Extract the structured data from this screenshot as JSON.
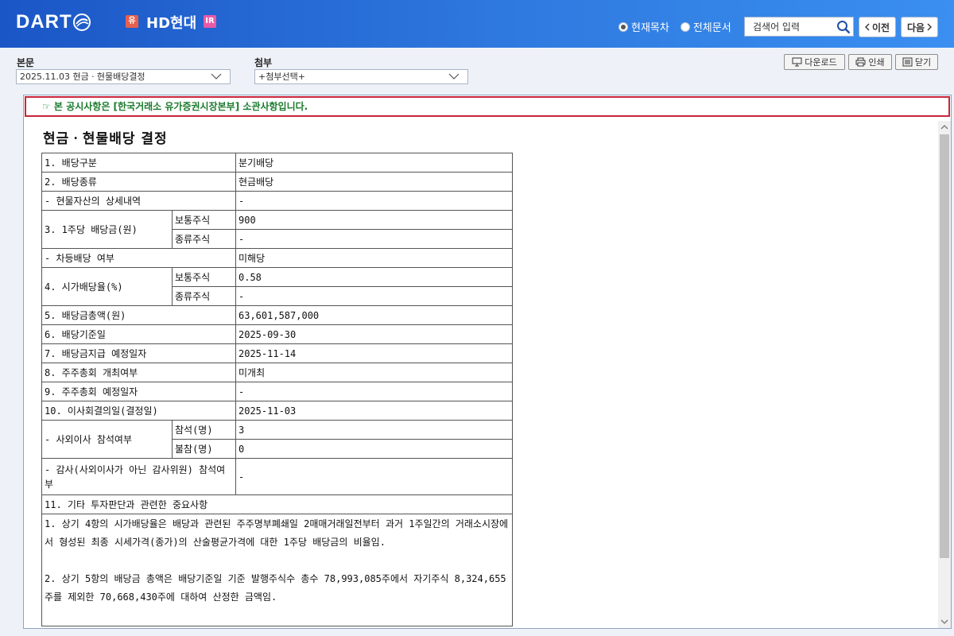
{
  "header": {
    "logo_text": "DART",
    "badge_left": "유",
    "company": "HD현대",
    "badge_right": "IR",
    "radio": [
      {
        "label": "현재목차",
        "checked": true
      },
      {
        "label": "전체문서",
        "checked": false
      }
    ],
    "search_placeholder": "검색어 입력",
    "prev_label": "이전",
    "next_label": "다음"
  },
  "toolbar": {
    "main_label": "본문",
    "main_value": "2025.11.03  현금ㆍ현물배당결정",
    "attach_label": "첨부",
    "attach_value": "+첨부선택+",
    "download_label": "다운로드",
    "print_label": "인쇄",
    "close_label": "닫기"
  },
  "document": {
    "notice": "☞ 본 공시사항은 [한국거래소 유가증권시장본부] 소관사항입니다.",
    "title": "현금ㆍ현물배당 결정",
    "rows": {
      "r1_label": "1. 배당구분",
      "r1_value": "분기배당",
      "r2_label": "2. 배당종류",
      "r2_value": "현금배당",
      "r3_label": "- 현물자산의 상세내역",
      "r3_value": "-",
      "r4_label": "3. 1주당 배당금(원)",
      "r4_sub1": "보통주식",
      "r4_val1": "900",
      "r4_sub2": "종류주식",
      "r4_val2": "-",
      "r5_label": "- 차등배당 여부",
      "r5_value": "미해당",
      "r6_label": "4. 시가배당율(%)",
      "r6_sub1": "보통주식",
      "r6_val1": "0.58",
      "r6_sub2": "종류주식",
      "r6_val2": "-",
      "r7_label": "5. 배당금총액(원)",
      "r7_value": "63,601,587,000",
      "r8_label": "6. 배당기준일",
      "r8_value": "2025-09-30",
      "r9_label": "7. 배당금지급 예정일자",
      "r9_value": "2025-11-14",
      "r10_label": "8. 주주총회 개최여부",
      "r10_value": "미개최",
      "r11_label": "9. 주주총회 예정일자",
      "r11_value": "-",
      "r12_label": "10. 이사회결의일(결정일)",
      "r12_value": "2025-11-03",
      "r13_label": "- 사외이사 참석여부",
      "r13_sub1": "참석(명)",
      "r13_val1": "3",
      "r13_sub2": "불참(명)",
      "r13_val2": "0",
      "r14_label": "- 감사(사외이사가 아닌 감사위원) 참석여부",
      "r14_value": "-",
      "r15_label": "11. 기타 투자판단과 관련한 중요사항"
    },
    "note1": "1. 상기 4항의 시가배당율은 배당과 관련된 주주명부폐쇄일 2매매거래일전부터 과거 1주일간의 거래소시장에서 형성된 최종 시세가격(종가)의 산술평균가격에 대한 1주당 배당금의 비율임.",
    "note2": "2. 상기 5항의 배당금 총액은 배당기준일 기준 발행주식수 총수 78,993,085주에서 자기주식 8,324,655주를 제외한 70,668,430주에 대하여 산정한 금액임."
  }
}
